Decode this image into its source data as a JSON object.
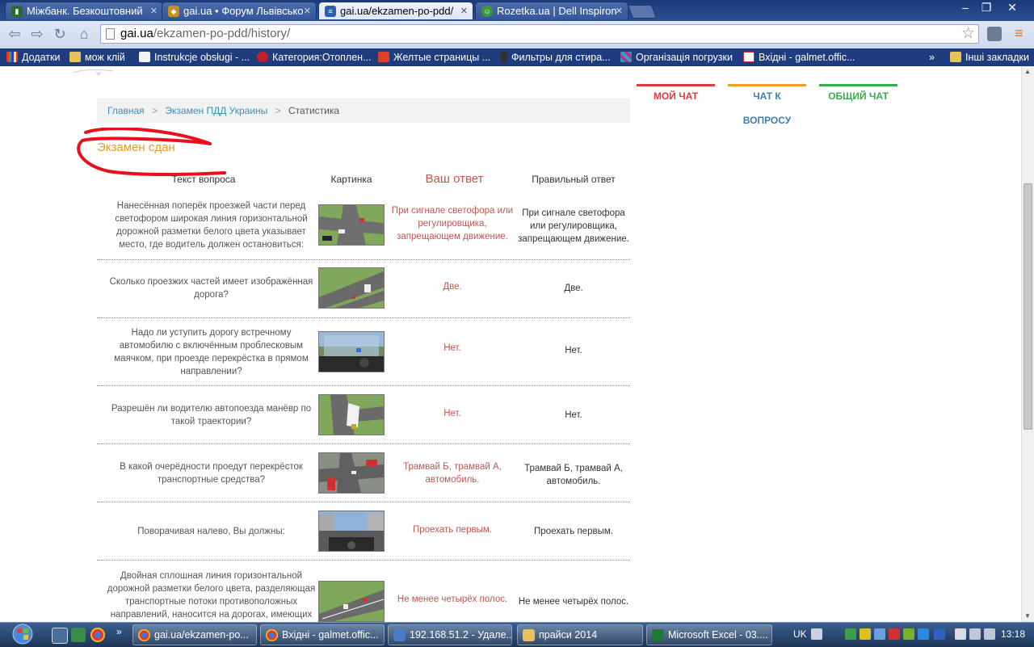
{
  "browser": {
    "tabs": [
      {
        "title": "Міжбанк. Безкоштовний",
        "favicon": "chart-bars-icon",
        "active": false
      },
      {
        "title": "gai.ua • Форум Львівсько",
        "favicon": "car-icon",
        "active": false
      },
      {
        "title": "gai.ua/ekzamen-po-pdd/",
        "favicon": "page-icon",
        "active": true
      },
      {
        "title": "Rozetka.ua | Dell Inspiron",
        "favicon": "rozetka-icon",
        "active": false
      }
    ],
    "url_host": "gai.ua",
    "url_path": "/ekzamen-po-pdd/history/",
    "bookmarks": [
      {
        "label": "Додатки",
        "icon": "apps-icon"
      },
      {
        "label": "мож клій",
        "icon": "folder-icon"
      },
      {
        "label": "Instrukcje obsługi - ...",
        "icon": "page-icon"
      },
      {
        "label": "Категория:Отоплен...",
        "icon": "ew-icon"
      },
      {
        "label": "Желтые страницы ...",
        "icon": "s-icon"
      },
      {
        "label": "Фильтры для стира...",
        "icon": "bottle-icon"
      },
      {
        "label": "Організація погрузки",
        "icon": "grid-icon"
      },
      {
        "label": "Вхідні - galmet.offic...",
        "icon": "gmail-icon"
      }
    ],
    "bookmarks_more": "»",
    "other_bookmarks": "Інші закладки"
  },
  "breadcrumb": {
    "home": "Главная",
    "exam": "Экзамен ПДД Украины",
    "current": "Статистика",
    "separator": ">"
  },
  "exam_result": "Экзамен сдан",
  "table": {
    "headers": {
      "question": "Текст вопроса",
      "picture": "Картинка",
      "your_answer": "Ваш ответ",
      "correct_answer": "Правильный ответ"
    },
    "rows": [
      {
        "question": "Нанесённая поперёк проезжей части перед светофором широкая линия горизонтальной дорожной разметки белого цвета указывает место, где водитель должен остановиться:",
        "your_answer": "При сигнале светофора или регулировщика, запрещающем движение.",
        "correct_answer": "При сигнале светофора или регулировщика, запрещающем движение."
      },
      {
        "question": "Сколько проезжих частей имеет изображённая дорога?",
        "your_answer": "Две.",
        "correct_answer": "Две."
      },
      {
        "question": "Надо ли уступить дорогу встречному автомобилю с включённым проблесковым маячком, при проезде перекрёстка в прямом направлении?",
        "your_answer": "Нет.",
        "correct_answer": "Нет."
      },
      {
        "question": "Разрешён ли водителю автопоезда манёвр по такой траектории?",
        "your_answer": "Нет.",
        "correct_answer": "Нет."
      },
      {
        "question": "В какой очерёдности проедут перекрёсток транспортные средства?",
        "your_answer": "Трамвай Б, трамвай А, автомобиль.",
        "correct_answer": "Трамвай Б, трамвай А, автомобиль."
      },
      {
        "question": "Поворачивая налево, Вы должны:",
        "your_answer": "Проехать первым.",
        "correct_answer": "Проехать первым."
      },
      {
        "question": "Двойная сплошная линия горизонтальной дорожной разметки белого цвета, разделяющая транспортные потоки противоположных направлений, наносится на дорогах, имеющих",
        "your_answer": "Не менее четырёх полос.",
        "correct_answer": "Не менее четырёх полос."
      }
    ]
  },
  "chat_tabs": [
    {
      "label": "МОЙ ЧАТ",
      "color": "#e03a3a"
    },
    {
      "label": "ЧАТ К ВОПРОСУ",
      "color": "#f0a020"
    },
    {
      "label": "ОБЩИЙ ЧАТ",
      "color": "#3aaa4a"
    }
  ],
  "colors": {
    "accent_orange": "#e49b2a",
    "your_answer_red": "#c0574f",
    "link_blue": "#3e8fb7",
    "annotation_red": "#e8101c"
  },
  "taskbar": {
    "items": [
      {
        "label": "gai.ua/ekzamen-po...",
        "icon": "chrome-icon"
      },
      {
        "label": "Вхідні - galmet.offic...",
        "icon": "chrome-icon"
      },
      {
        "label": "192.168.51.2 - Удале...",
        "icon": "remote-desktop-icon"
      },
      {
        "label": "прайси 2014",
        "icon": "folder-icon"
      },
      {
        "label": "Microsoft Excel - 03....",
        "icon": "excel-icon"
      }
    ],
    "language": "UK",
    "clock": "13:18"
  }
}
